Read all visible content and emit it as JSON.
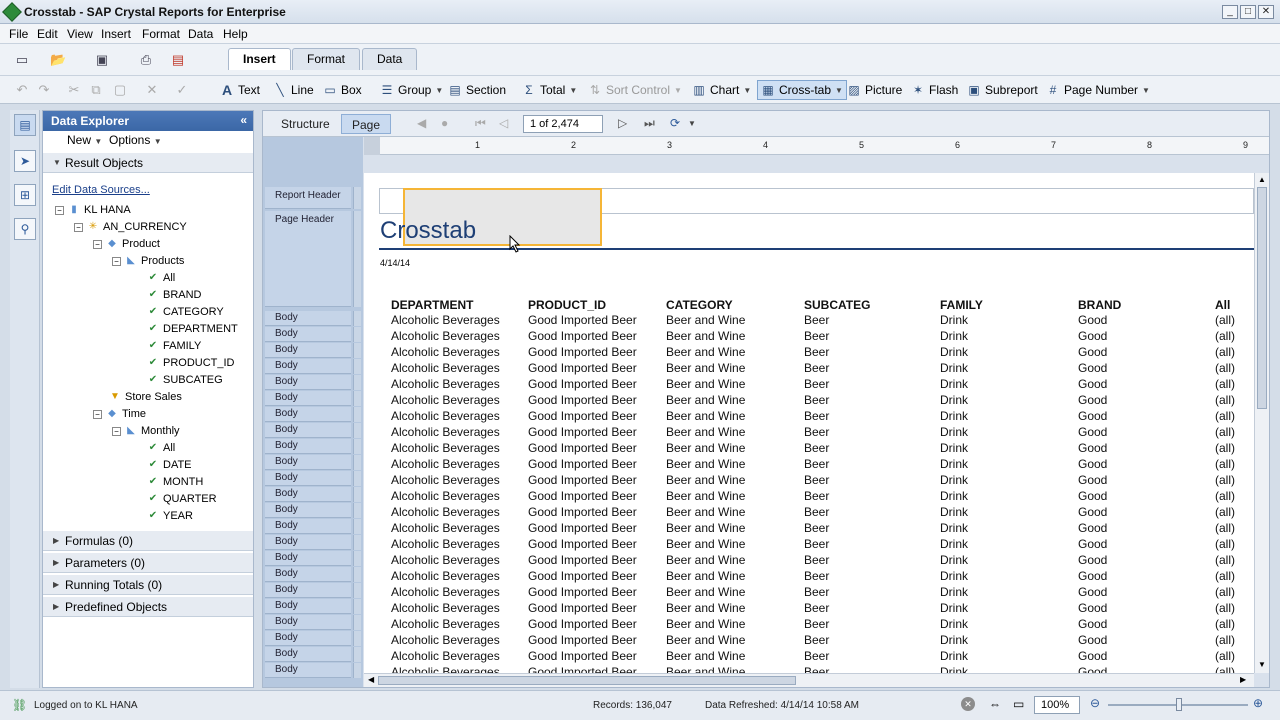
{
  "window": {
    "title": "Crosstab - SAP Crystal Reports for Enterprise"
  },
  "menu": [
    "File",
    "Edit",
    "View",
    "Insert",
    "Format",
    "Data",
    "Help"
  ],
  "ribbon_tabs": [
    "Insert",
    "Format",
    "Data"
  ],
  "insert_items": [
    "Text",
    "Line",
    "Box",
    "Group",
    "Section",
    "Total",
    "Sort Control",
    "Chart",
    "Cross-tab",
    "Picture",
    "Flash",
    "Subreport",
    "Page Number"
  ],
  "explorer": {
    "title": "Data Explorer",
    "new_label": "New",
    "options_label": "Options",
    "result_objects": "Result Objects",
    "edit_sources": "Edit Data Sources...",
    "tree": {
      "source": "KL HANA",
      "currency": "AN_CURRENCY",
      "product": "Product",
      "products": "Products",
      "product_fields": [
        "All",
        "BRAND",
        "CATEGORY",
        "DEPARTMENT",
        "FAMILY",
        "PRODUCT_ID",
        "SUBCATEG"
      ],
      "store_sales": "Store Sales",
      "time": "Time",
      "monthly": "Monthly",
      "time_fields": [
        "All",
        "DATE",
        "MONTH",
        "QUARTER",
        "YEAR"
      ]
    },
    "sections": [
      "Formulas (0)",
      "Parameters (0)",
      "Running Totals (0)",
      "Predefined Objects"
    ]
  },
  "view_tabs": {
    "structure": "Structure",
    "page": "Page"
  },
  "pager": "1 of 2,474",
  "ruler": [
    "1",
    "2",
    "3",
    "4",
    "5",
    "6",
    "7",
    "8",
    "9"
  ],
  "sections": {
    "report_header": "Report Header",
    "page_header": "Page Header",
    "body": "Body"
  },
  "report": {
    "title": "Crosstab",
    "date": "4/14/14",
    "columns": [
      "DEPARTMENT",
      "PRODUCT_ID",
      "CATEGORY",
      "SUBCATEG",
      "FAMILY",
      "BRAND",
      "All"
    ],
    "row": [
      "Alcoholic Beverages",
      "Good Imported Beer",
      "Beer and Wine",
      "Beer",
      "Drink",
      "Good",
      "(all)"
    ],
    "row_count_visible": 23
  },
  "status": {
    "logged": "Logged on to KL HANA",
    "records": "Records: 136,047",
    "refreshed": "Data Refreshed: 4/14/14 10:58 AM",
    "zoom": "100%"
  }
}
